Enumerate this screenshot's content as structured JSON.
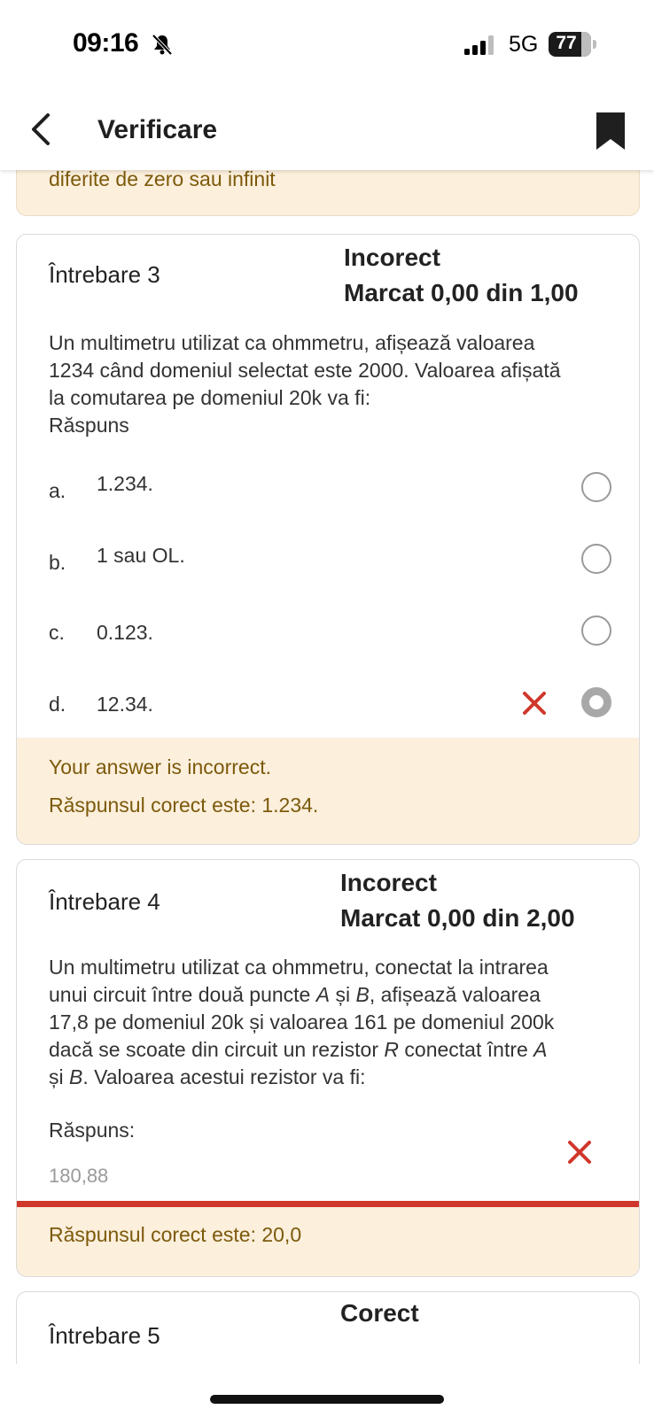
{
  "status": {
    "time": "09:16",
    "network": "5G",
    "battery": "77",
    "battery_level_percent": 77
  },
  "header": {
    "title": "Verificare",
    "back_icon": "chevron-left-icon",
    "bookmark_icon": "bookmark-icon"
  },
  "previous_feedback": {
    "text": "diferite de zero sau infinit"
  },
  "q3": {
    "label": "Întrebare 3",
    "state": "Incorect",
    "mark": "Marcat 0,00 din 1,00",
    "text_lines": [
      "Un multimetru utilizat ca ohmmetru, afișează valoarea",
      "1234 când domeniul selectat este 2000. Valoarea afișată",
      "la comutarea pe domeniul 20k va fi:"
    ],
    "answer_label": "Răspuns",
    "options": [
      {
        "letter": "a.",
        "text": "1.234.",
        "selected": false
      },
      {
        "letter": "b.",
        "text": "1 sau OL.",
        "selected": false
      },
      {
        "letter": "c.",
        "text": "0.123.",
        "selected": false
      },
      {
        "letter": "d.",
        "text": "12.34.",
        "selected": true
      }
    ],
    "feedback_incorrect": "Your answer is incorrect.",
    "feedback_correct": "Răspunsul corect este: 1.234."
  },
  "q4": {
    "label": "Întrebare 4",
    "state": "Incorect",
    "mark": "Marcat 0,00 din 2,00",
    "text": {
      "l1": "Un multimetru utilizat ca ohmmetru, conectat la intrarea",
      "l2_a": "unui circuit între două puncte ",
      "l2_A": "A",
      "l2_b": " și ",
      "l2_B": "B",
      "l2_c": ", afișează valoarea",
      "l3": "17,8 pe domeniul 20k și valoarea 161 pe domeniul 200k",
      "l4_a": "dacă se scoate din circuit un rezistor ",
      "l4_R": "R",
      "l4_b": " conectat între ",
      "l4_A": "A",
      "l5_a": "și ",
      "l5_B": "B",
      "l5_b": ". Valoarea acestui rezistor va fi:"
    },
    "answer_label": "Răspuns:",
    "answer_value": "180,88",
    "feedback_correct": "Răspunsul corect este: 20,0"
  },
  "q5": {
    "label": "Întrebare 5",
    "state": "Corect"
  },
  "colors": {
    "feedback_bg": "#fcefdc",
    "feedback_text": "#7c5a0b",
    "error_red": "#d0372b"
  }
}
